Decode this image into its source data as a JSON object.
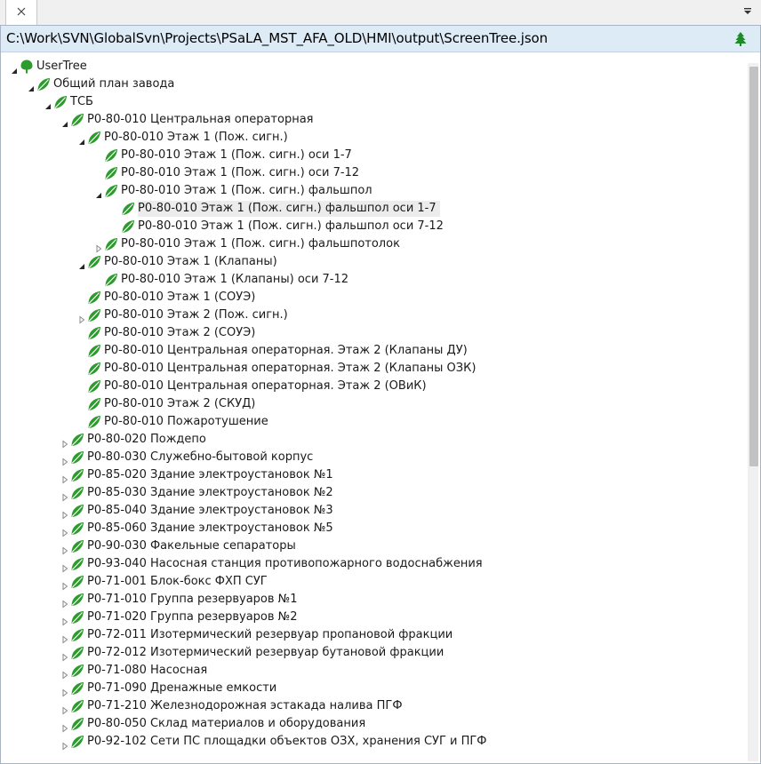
{
  "tab": {
    "close_icon": "close-icon"
  },
  "toolbar": {
    "overflow_icon": "chevron-down-icon",
    "tree_icon": "tree-icon"
  },
  "path": "C:\\Work\\SVN\\GlobalSvn\\Projects\\PSaLA_MST_AFA_OLD\\HMI\\output\\ScreenTree.json",
  "colors": {
    "leaf": "#2e9b2e",
    "leaf_dark": "#1d6f1d",
    "selection": "#ececec",
    "pathbar": "#ddebf7"
  },
  "tree": [
    {
      "label": "UserTree",
      "level": 0,
      "state": "expanded",
      "icon": "tree-node-icon"
    },
    {
      "label": "Общий план завода",
      "level": 1,
      "state": "expanded",
      "icon": "leaf-icon"
    },
    {
      "label": "ТСБ",
      "level": 2,
      "state": "expanded",
      "icon": "leaf-icon"
    },
    {
      "label": "Р0-80-010 Центральная операторная",
      "level": 3,
      "state": "expanded",
      "icon": "leaf-icon"
    },
    {
      "label": "Р0-80-010 Этаж 1 (Пож. сигн.)",
      "level": 4,
      "state": "expanded",
      "icon": "leaf-icon"
    },
    {
      "label": "Р0-80-010 Этаж 1 (Пож. сигн.) оси 1-7",
      "level": 5,
      "state": "none",
      "icon": "leaf-icon"
    },
    {
      "label": "Р0-80-010 Этаж 1 (Пож. сигн.) оси 7-12",
      "level": 5,
      "state": "none",
      "icon": "leaf-icon"
    },
    {
      "label": "Р0-80-010 Этаж 1 (Пож. сигн.) фальшпол",
      "level": 5,
      "state": "expanded",
      "icon": "leaf-icon"
    },
    {
      "label": "Р0-80-010 Этаж 1 (Пож. сигн.) фальшпол оси 1-7",
      "level": 6,
      "state": "none",
      "icon": "leaf-icon",
      "selected": true
    },
    {
      "label": "Р0-80-010 Этаж 1 (Пож. сигн.) фальшпол оси 7-12",
      "level": 6,
      "state": "none",
      "icon": "leaf-icon"
    },
    {
      "label": "Р0-80-010 Этаж 1 (Пож. сигн.) фальшпотолок",
      "level": 5,
      "state": "collapsed",
      "icon": "leaf-icon"
    },
    {
      "label": "Р0-80-010 Этаж 1 (Клапаны)",
      "level": 4,
      "state": "expanded",
      "icon": "leaf-icon"
    },
    {
      "label": "Р0-80-010 Этаж 1 (Клапаны) оси 7-12",
      "level": 5,
      "state": "none",
      "icon": "leaf-icon"
    },
    {
      "label": "Р0-80-010 Этаж 1 (СОУЭ)",
      "level": 4,
      "state": "none",
      "icon": "leaf-icon"
    },
    {
      "label": "Р0-80-010 Этаж 2 (Пож. сигн.)",
      "level": 4,
      "state": "collapsed",
      "icon": "leaf-icon"
    },
    {
      "label": "Р0-80-010 Этаж 2 (СОУЭ)",
      "level": 4,
      "state": "none",
      "icon": "leaf-icon"
    },
    {
      "label": "Р0-80-010 Центральная операторная. Этаж 2 (Клапаны ДУ)",
      "level": 4,
      "state": "none",
      "icon": "leaf-icon"
    },
    {
      "label": "Р0-80-010 Центральная операторная. Этаж 2 (Клапаны ОЗК)",
      "level": 4,
      "state": "none",
      "icon": "leaf-icon"
    },
    {
      "label": "Р0-80-010 Центральная операторная. Этаж 2 (ОВиК)",
      "level": 4,
      "state": "none",
      "icon": "leaf-icon"
    },
    {
      "label": "Р0-80-010 Этаж 2 (СКУД)",
      "level": 4,
      "state": "none",
      "icon": "leaf-icon"
    },
    {
      "label": "Р0-80-010 Пожаротушение",
      "level": 4,
      "state": "none",
      "icon": "leaf-icon"
    },
    {
      "label": "Р0-80-020 Пождепо",
      "level": 3,
      "state": "collapsed",
      "icon": "leaf-icon"
    },
    {
      "label": "Р0-80-030 Служебно-бытовой корпус",
      "level": 3,
      "state": "collapsed",
      "icon": "leaf-icon"
    },
    {
      "label": "Р0-85-020 Здание электроустановок №1",
      "level": 3,
      "state": "collapsed",
      "icon": "leaf-icon"
    },
    {
      "label": "Р0-85-030 Здание электроустановок №2",
      "level": 3,
      "state": "collapsed",
      "icon": "leaf-icon"
    },
    {
      "label": "Р0-85-040 Здание электроустановок №3",
      "level": 3,
      "state": "collapsed",
      "icon": "leaf-icon"
    },
    {
      "label": "Р0-85-060 Здание электроустановок №5",
      "level": 3,
      "state": "collapsed",
      "icon": "leaf-icon"
    },
    {
      "label": "Р0-90-030 Факельные сепараторы",
      "level": 3,
      "state": "collapsed",
      "icon": "leaf-icon"
    },
    {
      "label": "Р0-93-040 Насосная станция противопожарного водоснабжения",
      "level": 3,
      "state": "collapsed",
      "icon": "leaf-icon"
    },
    {
      "label": "Р0-71-001 Блок-бокс ФХП СУГ",
      "level": 3,
      "state": "collapsed",
      "icon": "leaf-icon"
    },
    {
      "label": "Р0-71-010 Группа резервуаров №1",
      "level": 3,
      "state": "collapsed",
      "icon": "leaf-icon"
    },
    {
      "label": "Р0-71-020 Группа резервуаров №2",
      "level": 3,
      "state": "collapsed",
      "icon": "leaf-icon"
    },
    {
      "label": "Р0-72-011 Изотермический резервуар пропановой фракции",
      "level": 3,
      "state": "collapsed",
      "icon": "leaf-icon"
    },
    {
      "label": "Р0-72-012 Изотермический резервуар бутановой фракции",
      "level": 3,
      "state": "collapsed",
      "icon": "leaf-icon"
    },
    {
      "label": "Р0-71-080 Насосная",
      "level": 3,
      "state": "collapsed",
      "icon": "leaf-icon"
    },
    {
      "label": "Р0-71-090 Дренажные емкости",
      "level": 3,
      "state": "collapsed",
      "icon": "leaf-icon"
    },
    {
      "label": "Р0-71-210 Железнодорожная эстакада налива ПГФ",
      "level": 3,
      "state": "collapsed",
      "icon": "leaf-icon"
    },
    {
      "label": "Р0-80-050 Склад материалов и оборудования",
      "level": 3,
      "state": "collapsed",
      "icon": "leaf-icon"
    },
    {
      "label": "Р0-92-102 Сети ПС площадки объектов ОЗХ, хранения СУГ и ПГФ",
      "level": 3,
      "state": "collapsed",
      "icon": "leaf-icon"
    }
  ]
}
